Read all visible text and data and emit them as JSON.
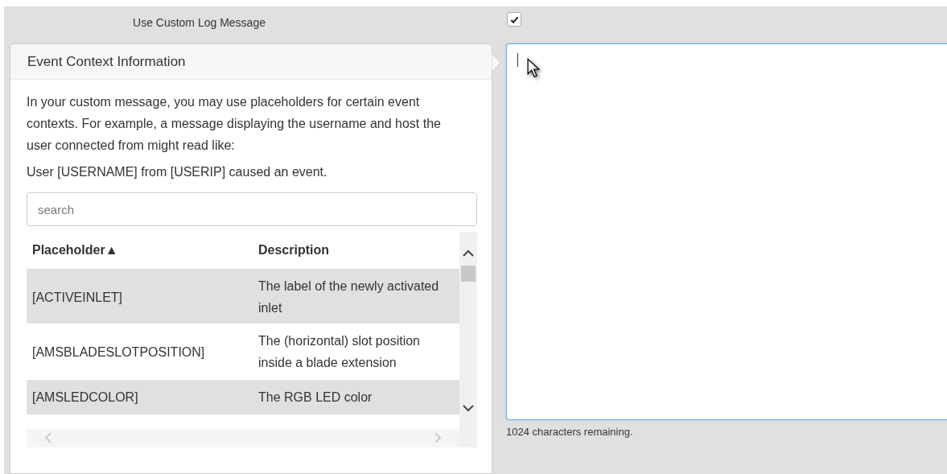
{
  "setting": {
    "label": "Use Custom Log Message",
    "checked": true
  },
  "popover": {
    "title": "Event Context Information",
    "paragraphs": [
      "In your custom message, you may use placeholders for certain event contexts. For example, a message displaying the username and host the user connected from might read like:",
      "User [USERNAME] from [USERIP] caused an event."
    ],
    "search": {
      "placeholder": "search"
    },
    "table": {
      "columns": [
        {
          "label": "Placeholder",
          "sort_indicator": "▲"
        },
        {
          "label": "Description"
        }
      ],
      "rows": [
        {
          "placeholder": "[ACTIVEINLET]",
          "description": "The label of the newly activated inlet"
        },
        {
          "placeholder": "[AMSBLADESLOTPOSITION]",
          "description": "The (horizontal) slot position inside a blade extension"
        },
        {
          "placeholder": "[AMSLEDCOLOR]",
          "description": "The RGB LED color"
        }
      ]
    }
  },
  "message": {
    "counter": "1024 characters remaining."
  }
}
